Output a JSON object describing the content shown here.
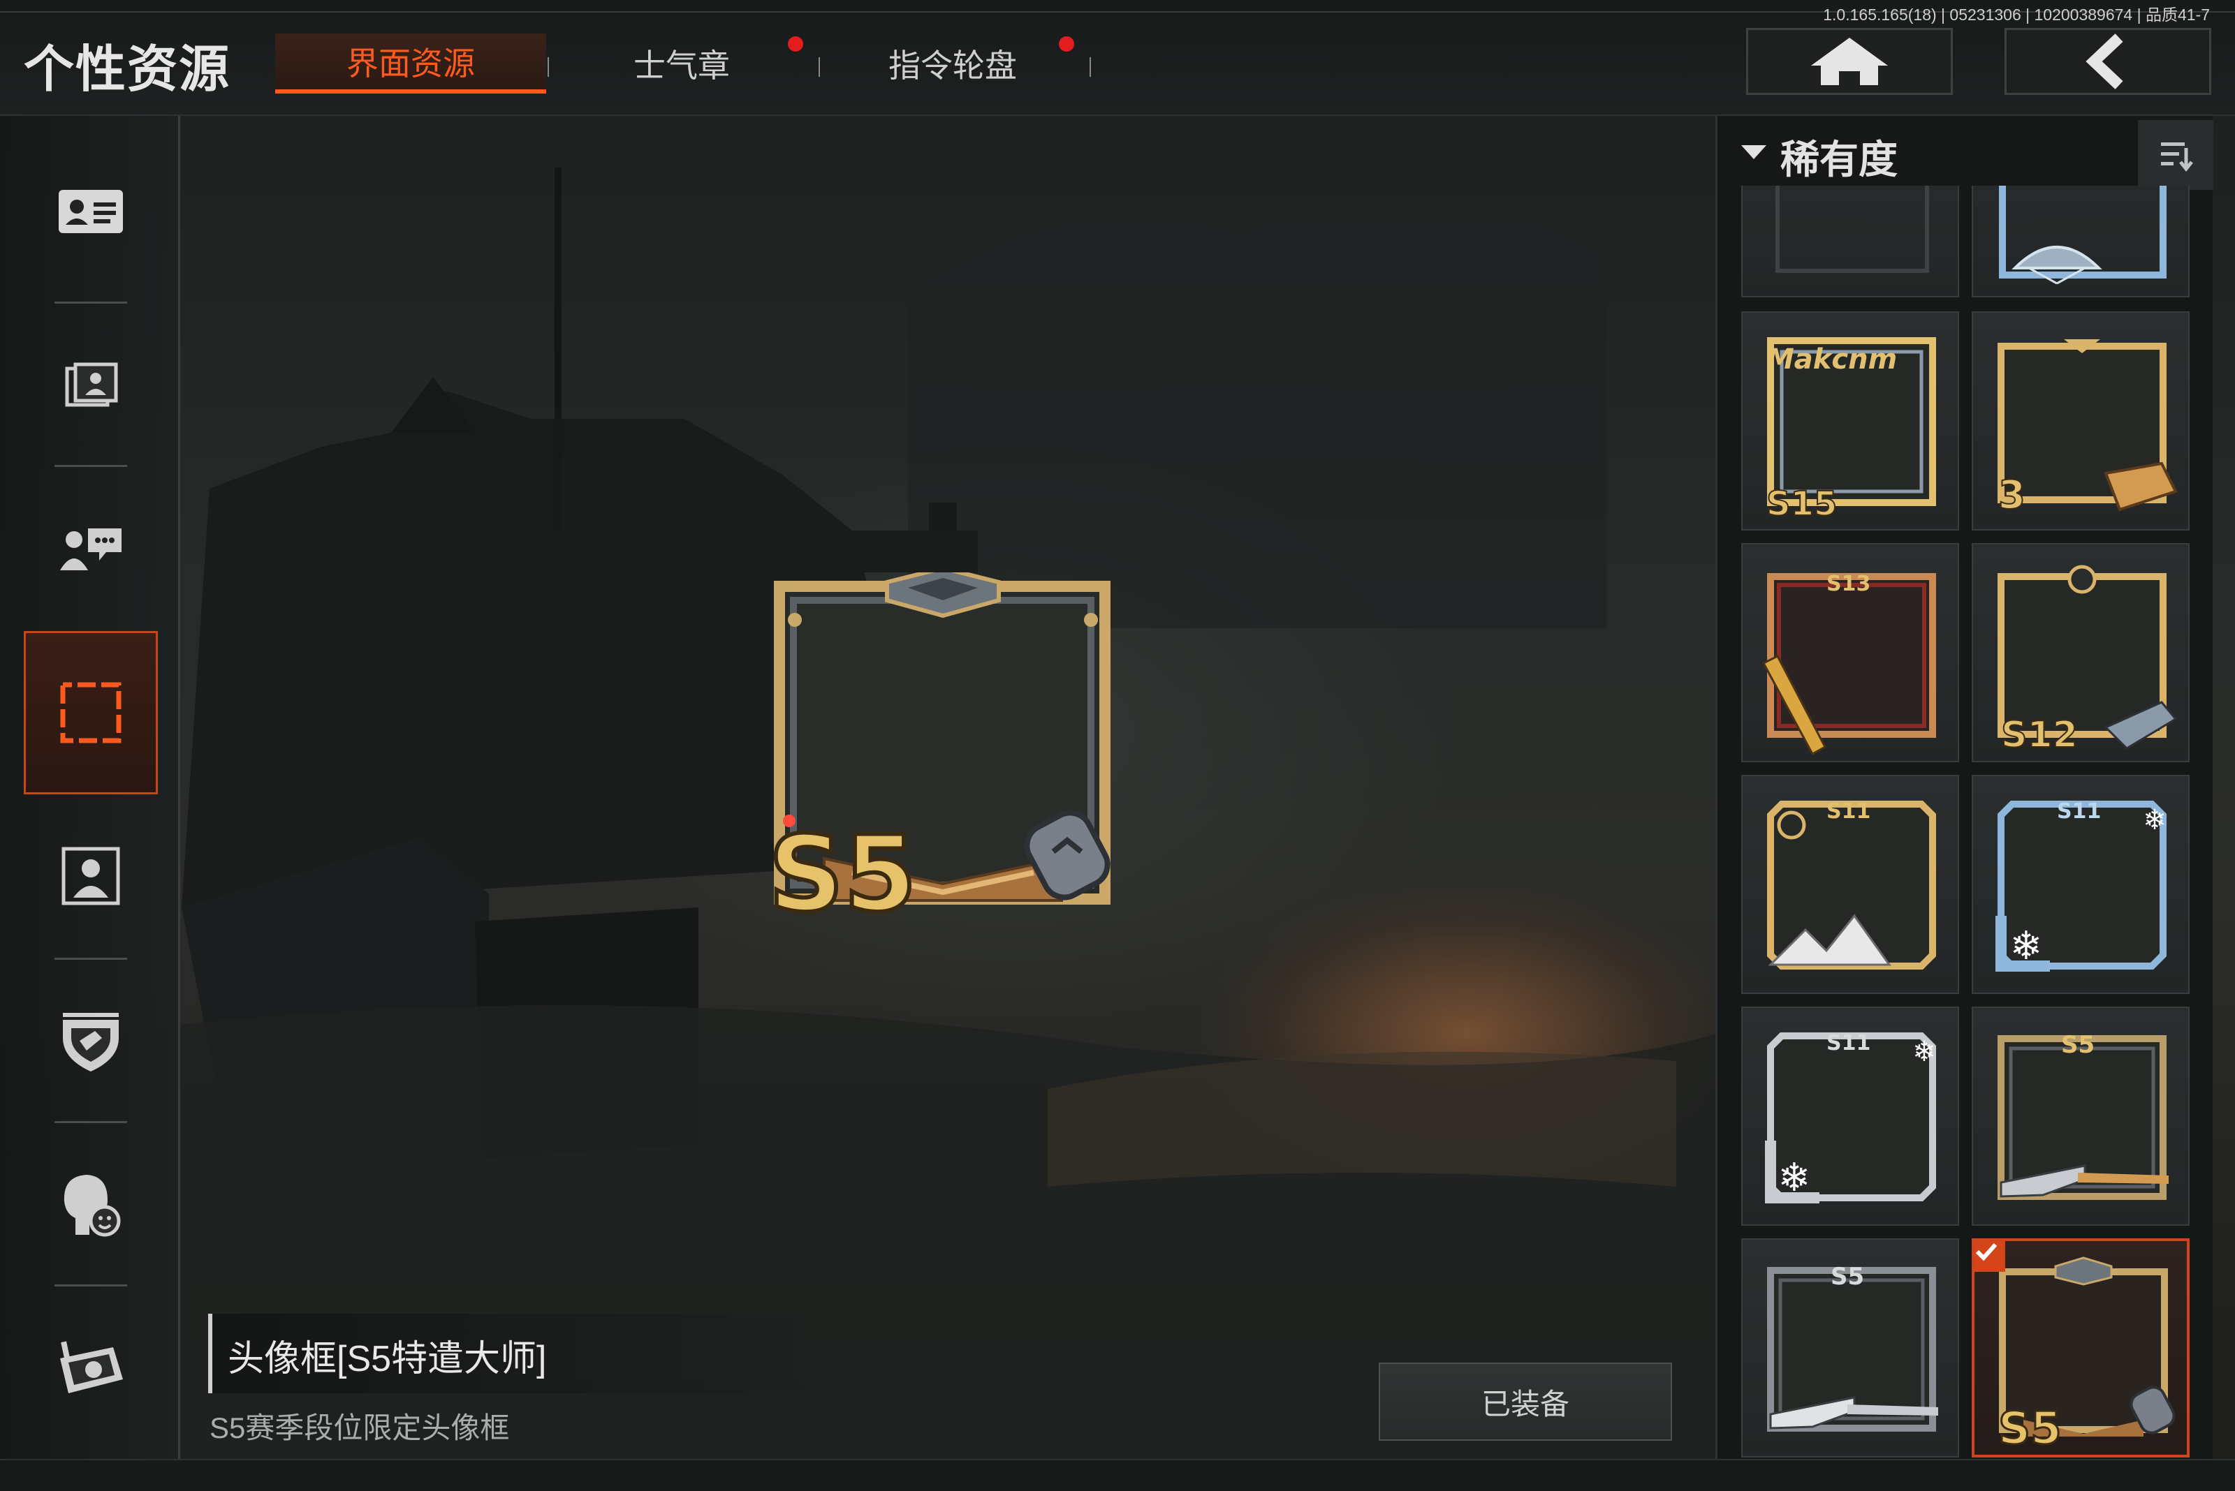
{
  "header": {
    "title": "个性资源",
    "version_info": "1.0.165.165(18) | 05231306 | 10200389674 | 品质41-7"
  },
  "tabs": [
    {
      "label": "界面资源",
      "active": true,
      "badge": false
    },
    {
      "label": "士气章",
      "active": false,
      "badge": true
    },
    {
      "label": "指令轮盘",
      "active": false,
      "badge": true
    }
  ],
  "nav": {
    "home_icon": "home-icon",
    "back_icon": "back-arrow-icon"
  },
  "sidebar": {
    "items": [
      {
        "icon": "id-card-icon",
        "active": false
      },
      {
        "icon": "photo-card-icon",
        "active": false
      },
      {
        "icon": "chat-bubble-icon",
        "active": false
      },
      {
        "icon": "avatar-frame-icon",
        "active": true
      },
      {
        "icon": "portrait-icon",
        "active": false
      },
      {
        "icon": "badge-shield-icon",
        "active": false
      },
      {
        "icon": "head-emote-icon",
        "active": false
      },
      {
        "icon": "radio-device-icon",
        "active": false
      }
    ]
  },
  "selected_item": {
    "name": "头像框[S5特遣大师]",
    "description": "S5赛季段位限定头像框",
    "status_label": "已装备"
  },
  "filter": {
    "label": "稀有度",
    "sort_icon": "sort-icon"
  },
  "grid_items": [
    {
      "frame": "blank",
      "selected": false
    },
    {
      "frame": "parachute-frame",
      "selected": false
    },
    {
      "frame": "S15",
      "selected": false
    },
    {
      "frame": "crate-3",
      "selected": false
    },
    {
      "frame": "S13",
      "selected": false
    },
    {
      "frame": "S12",
      "selected": false
    },
    {
      "frame": "S11",
      "selected": false
    },
    {
      "frame": "S11",
      "selected": false
    },
    {
      "frame": "S11",
      "selected": false
    },
    {
      "frame": "S5",
      "selected": false
    },
    {
      "frame": "S5",
      "selected": false
    },
    {
      "frame": "S5",
      "selected": true
    }
  ],
  "frame_labels": {
    "S15_tag": "Makcnm",
    "S15": "S15",
    "crate": "3",
    "S13": "S13",
    "S12": "S12",
    "S11": "S11",
    "S5": "S5"
  },
  "colors": {
    "accent": "#ff5a1e",
    "badge": "#e11d1d",
    "gold": "#d9b46a",
    "blue": "#8fb7dc",
    "silver": "#c8ccd0"
  }
}
